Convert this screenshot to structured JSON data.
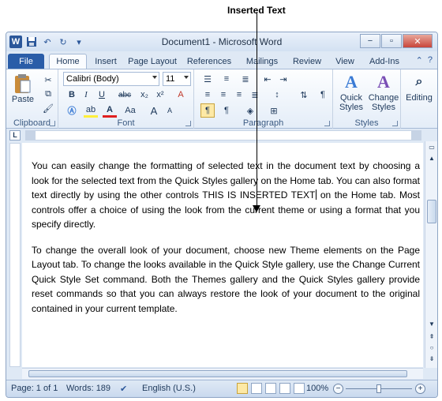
{
  "annotation": {
    "label": "Inserted Text"
  },
  "window": {
    "title": "Document1 - Microsoft Word",
    "app_logo": "W",
    "min_label": "−",
    "max_label": "▫",
    "close_label": "✕"
  },
  "qat": {
    "save_icon": "💾",
    "undo_icon": "↶",
    "redo_icon": "↻",
    "customize_icon": "▾"
  },
  "tabs": {
    "file": "File",
    "items": [
      "Home",
      "Insert",
      "Page Layout",
      "References",
      "Mailings",
      "Review",
      "View",
      "Add-Ins"
    ],
    "help_icon": "?"
  },
  "ribbon": {
    "clipboard": {
      "label": "Clipboard",
      "paste": "Paste"
    },
    "font": {
      "label": "Font",
      "family": "Calibri (Body)",
      "size": "11",
      "bold": "B",
      "italic": "I",
      "underline": "U",
      "strike": "abc",
      "subscript": "x₂",
      "superscript": "x²",
      "clear": "A",
      "grow": "A",
      "shrink": "A",
      "case": "Aa",
      "color": "A",
      "highlight": "ab"
    },
    "paragraph": {
      "label": "Paragraph",
      "show_marks": "¶"
    },
    "styles": {
      "label": "Styles",
      "quick_styles_1": "Quick",
      "quick_styles_2": "Styles",
      "change_styles_1": "Change",
      "change_styles_2": "Styles"
    },
    "editing": {
      "label": "Editing"
    }
  },
  "ruler": {
    "tab_selector": "L"
  },
  "document": {
    "para1_before": "You can easily change the formatting of selected text in the document text by choosing a look for the selected text from the Quick Styles gallery on the Home tab. You can also format text directly by using the other controls ",
    "inserted": "THIS IS INSERTED TEXT",
    "para1_after": " on the Home tab. Most controls offer a choice of using the look from the current theme or using a format that you specify directly.",
    "para2": "To change the overall look of your document, choose new Theme elements on the Page Layout tab. To change the looks available in the Quick Style gallery, use the Change Current Quick Style Set command. Both the Themes gallery and the Quick Styles gallery provide reset commands so that you can always restore the look of your document to the original contained in your current template."
  },
  "status": {
    "page": "Page: 1 of 1",
    "words": "Words: 189",
    "language": "English (U.S.)",
    "zoom": "100%",
    "zoom_out": "−",
    "zoom_in": "+",
    "zoom_level": 1.0
  },
  "colors": {
    "file_tab": "#2a5da8",
    "ribbon_bg": "#e4edf8",
    "accent": "#2b579a"
  }
}
